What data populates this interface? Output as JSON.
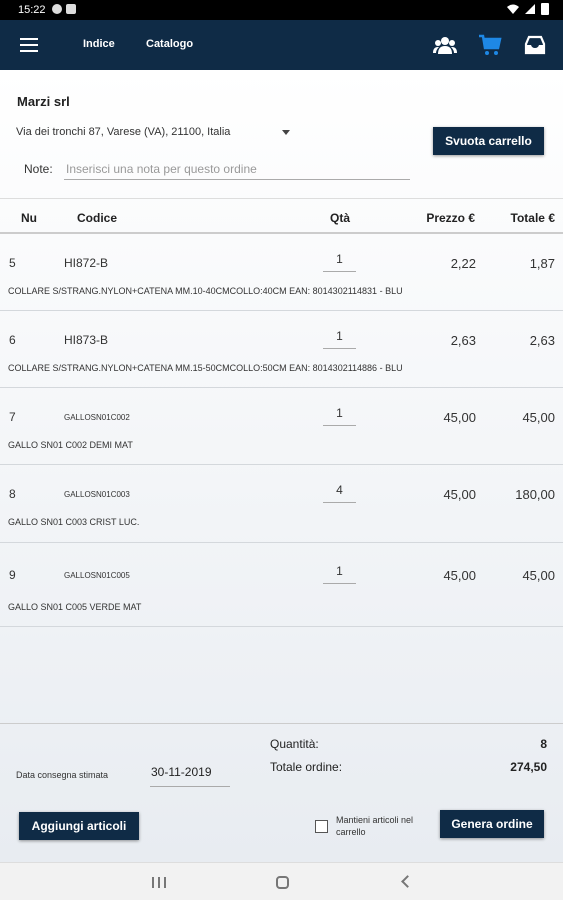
{
  "status_bar": {
    "time": "15:22"
  },
  "app_bar": {
    "menu_icon": "hamburger-menu-icon",
    "nav": {
      "indice": "Indice",
      "catalogo": "Catalogo"
    },
    "icons": [
      "users-icon",
      "cart-icon",
      "inbox-icon"
    ],
    "accent_color": "#1e88e5",
    "bar_color": "#0f2b46"
  },
  "order": {
    "customer_name": "Marzi srl",
    "address": "Via dei tronchi 87, Varese (VA), 21100, Italia",
    "empty_cart_label": "Svuota carrello",
    "note_label": "Note:",
    "note_placeholder": "Inserisci una nota per questo ordine"
  },
  "table": {
    "headers": {
      "nu": "Nu",
      "codice": "Codice",
      "qta": "Qtà",
      "prezzo": "Prezzo €",
      "totale": "Totale €"
    },
    "rows": [
      {
        "nu": "5",
        "code": "HI872-B",
        "qty": "1",
        "price": "2,22",
        "total": "1,87",
        "desc": "COLLARE S/STRANG.NYLON+CATENA MM.10-40CMCOLLO:40CM EAN: 8014302114831 - BLU"
      },
      {
        "nu": "6",
        "code": "HI873-B",
        "qty": "1",
        "price": "2,63",
        "total": "2,63",
        "desc": "COLLARE S/STRANG.NYLON+CATENA MM.15-50CMCOLLO:50CM EAN: 8014302114886 - BLU"
      },
      {
        "nu": "7",
        "code": "GALLOSN01C002",
        "qty": "1",
        "price": "45,00",
        "total": "45,00",
        "desc": "GALLO SN01 C002  DEMI MAT"
      },
      {
        "nu": "8",
        "code": "GALLOSN01C003",
        "qty": "4",
        "price": "45,00",
        "total": "180,00",
        "desc": "GALLO SN01 C003  CRIST LUC."
      },
      {
        "nu": "9",
        "code": "GALLOSN01C005",
        "qty": "1",
        "price": "45,00",
        "total": "45,00",
        "desc": "GALLO SN01 C005  VERDE MAT"
      }
    ]
  },
  "footer": {
    "qty_label": "Quantità:",
    "qty_value": "8",
    "total_label": "Totale ordine:",
    "total_value": "274,50",
    "delivery_label": "Data consegna stimata",
    "delivery_date": "30-11-2019",
    "add_items_label": "Aggiungi articoli",
    "keep_items_label": "Mantieni articoli nel carrello",
    "keep_items_checked": false,
    "generate_label": "Genera ordine"
  }
}
